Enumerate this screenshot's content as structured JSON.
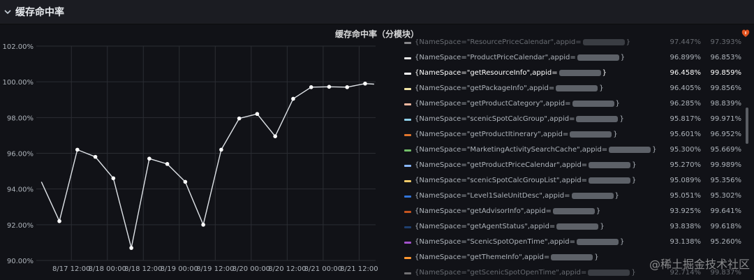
{
  "row": {
    "title": "缓存命中率",
    "collapse_icon": "chevron-down-icon"
  },
  "panel": {
    "title": "缓存命中率（分模块）",
    "alert_icon": "alert-heart-icon"
  },
  "watermark": "@稀土掘金技术社区",
  "colors": {
    "background": "#111217",
    "series_line": "#dfe3e8",
    "grid": "#2b2d33",
    "axis_text": "#aeb4bb"
  },
  "legend": [
    {
      "name": "{NameSpace=\"ResourcePriceCalendar\",appid=",
      "close": "}",
      "v1": "97.447%",
      "v2": "97.393%",
      "color": "#e8e8e8",
      "clipped": true
    },
    {
      "name": "{NameSpace=\"ProductPriceCalendar\",appid=",
      "close": "}",
      "v1": "96.899%",
      "v2": "96.853%",
      "color": "#e8e8e8"
    },
    {
      "name": "{NameSpace=\"getResourceInfo\",appid=",
      "close": "}",
      "v1": "96.458%",
      "v2": "99.859%",
      "color": "#ffffff",
      "highlight": true
    },
    {
      "name": "{NameSpace=\"getPackageInfo\",appid=",
      "close": "}",
      "v1": "96.405%",
      "v2": "99.856%",
      "color": "#f2e6a8"
    },
    {
      "name": "{NameSpace=\"getProductCategory\",appid=",
      "close": "}",
      "v1": "96.285%",
      "v2": "98.839%",
      "color": "#f2b8a0"
    },
    {
      "name": "{NameSpace=\"scenicSpotCalcGroup\",appid=",
      "close": "}",
      "v1": "95.817%",
      "v2": "99.971%",
      "color": "#8fd0e8"
    },
    {
      "name": "{NameSpace=\"getProductItinerary\",appid=",
      "close": "}",
      "v1": "95.601%",
      "v2": "96.952%",
      "color": "#e0752d"
    },
    {
      "name": "{NameSpace=\"MarketingActivitySearchCache\",appid=",
      "close": "}",
      "v1": "95.300%",
      "v2": "95.669%",
      "color": "#73bf69"
    },
    {
      "name": "{NameSpace=\"getProductPriceCalendar\",appid=",
      "close": "}",
      "v1": "95.270%",
      "v2": "99.989%",
      "color": "#8ab8ff"
    },
    {
      "name": "{NameSpace=\"scenicSpotCalcGroupList\",appid=",
      "close": "}",
      "v1": "95.089%",
      "v2": "95.356%",
      "color": "#f2cc6b"
    },
    {
      "name": "{NameSpace=\"Level1SaleUnitDesc\",appid=",
      "close": "}",
      "v1": "95.051%",
      "v2": "95.302%",
      "color": "#3274d9"
    },
    {
      "name": "{NameSpace=\"getAdvisorInfo\",appid=",
      "close": "}",
      "v1": "93.925%",
      "v2": "99.641%",
      "color": "#c4541f"
    },
    {
      "name": "{NameSpace=\"getAgentStatus\",appid=",
      "close": "}",
      "v1": "93.838%",
      "v2": "99.618%",
      "color": "#1f3f6e"
    },
    {
      "name": "{NameSpace=\"ScenicSpotOpenTime\",appid=",
      "close": "}",
      "v1": "93.138%",
      "v2": "95.260%",
      "color": "#a352cc"
    },
    {
      "name": "{NameSpace=\"getThemeInfo\",appid=",
      "close": "}",
      "v1": "",
      "v2": "",
      "color": "#ff9830"
    },
    {
      "name": "{NameSpace=\"getScenicSpotOpenTime\",appid=",
      "close": "}",
      "v1": "92.714%",
      "v2": "99.837%",
      "color": "#c0c0c0",
      "clipped": true
    }
  ],
  "chart_data": {
    "type": "line",
    "title": "缓存命中率（分模块）",
    "xlabel": "",
    "ylabel": "",
    "ylim": [
      90,
      102
    ],
    "y_ticks": [
      "102.00%",
      "100.00%",
      "98.00%",
      "96.00%",
      "94.00%",
      "92.00%",
      "90.00%"
    ],
    "x_ticks": [
      "8/17 12:00",
      "8/18 00:00",
      "8/18 12:00",
      "8/19 00:00",
      "8/19 12:00",
      "8/20 00:00",
      "8/20 12:00",
      "8/21 00:00",
      "8/21 12:00"
    ],
    "grid": true,
    "legend_position": "right",
    "series": [
      {
        "name": "{NameSpace=\"getResourceInfo\",appid=",
        "x": [
          "8/17 02:00",
          "8/17 08:00",
          "8/17 14:00",
          "8/17 20:00",
          "8/18 02:00",
          "8/18 08:00",
          "8/18 14:00",
          "8/18 20:00",
          "8/19 02:00",
          "8/19 08:00",
          "8/19 14:00",
          "8/19 20:00",
          "8/20 02:00",
          "8/20 08:00",
          "8/20 14:00",
          "8/20 20:00",
          "8/21 02:00",
          "8/21 08:00",
          "8/21 14:00",
          "8/21 17:00"
        ],
        "values": [
          94.4,
          92.2,
          96.2,
          95.8,
          94.6,
          90.7,
          95.7,
          95.4,
          94.4,
          92.0,
          96.2,
          97.95,
          98.2,
          96.95,
          99.05,
          99.7,
          99.72,
          99.7,
          99.9,
          99.87
        ],
        "markers": [
          false,
          true,
          true,
          true,
          true,
          true,
          true,
          true,
          true,
          true,
          true,
          true,
          true,
          true,
          true,
          true,
          true,
          true,
          true,
          false
        ]
      }
    ]
  }
}
